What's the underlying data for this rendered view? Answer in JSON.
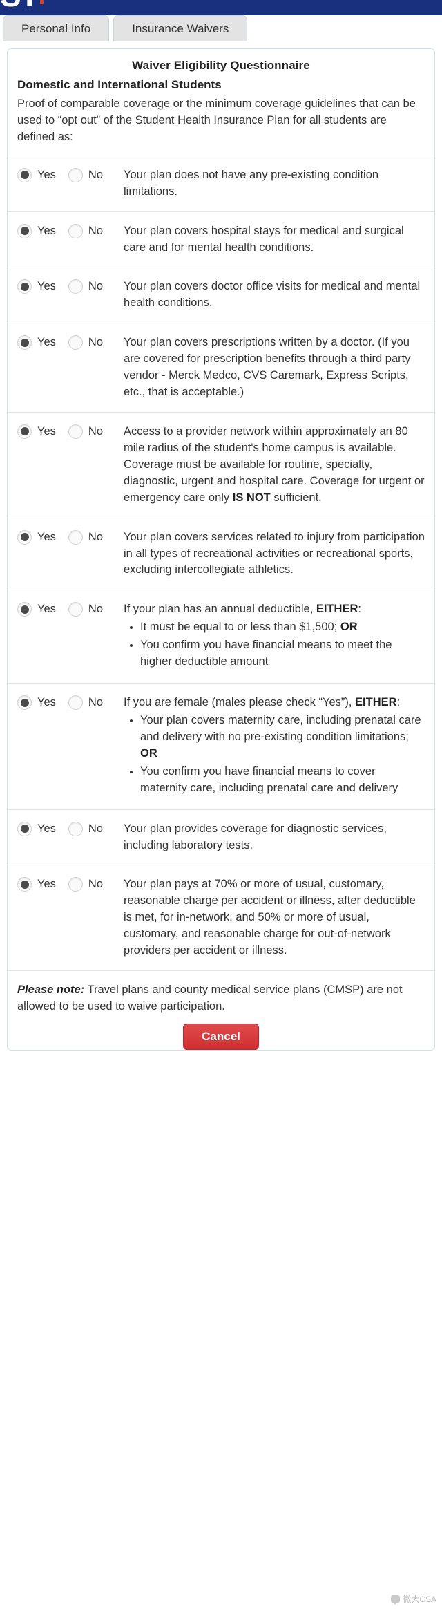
{
  "header": {
    "logo_text": "ST",
    "bar_color": "#18307e",
    "accent_color": "#c8472f"
  },
  "tabs": [
    {
      "label": "Personal Info",
      "name": "tab-personal-info",
      "selected": false
    },
    {
      "label": "Insurance Waivers",
      "name": "tab-insurance-waivers",
      "selected": true
    }
  ],
  "card": {
    "title": "Waiver Eligibility Questionnaire",
    "subtitle": "Domestic and International Students",
    "intro": "Proof of comparable coverage or the minimum coverage guidelines that can be used to “opt out” of the Student Health Insurance Plan for all students are defined as:"
  },
  "options": {
    "yes_label": "Yes",
    "no_label": "No"
  },
  "questions": [
    {
      "id": "q1-preexisting",
      "selected": "yes",
      "text": "Your plan does not have any pre-existing condition limitations."
    },
    {
      "id": "q2-hospital",
      "selected": "yes",
      "text": "Your plan covers hospital stays for medical and surgical care and for mental health conditions."
    },
    {
      "id": "q3-doctor-visits",
      "selected": "yes",
      "text": "Your plan covers doctor office visits for medical and mental health conditions."
    },
    {
      "id": "q4-prescriptions",
      "selected": "yes",
      "text": "Your plan covers prescriptions written by a doctor. (If you are covered for prescription benefits through a third party vendor - Merck Medco, CVS Caremark, Express Scripts, etc., that is acceptable.)"
    },
    {
      "id": "q5-provider-network",
      "selected": "yes",
      "text_parts": [
        {
          "type": "text",
          "value": "Access to a provider network within approximately an 80 mile radius of the student's home campus is available. Coverage must be available for routine, specialty, diagnostic, urgent and hospital care. Coverage for urgent or emergency care only "
        },
        {
          "type": "bold",
          "value": "IS NOT"
        },
        {
          "type": "text",
          "value": " sufficient."
        }
      ]
    },
    {
      "id": "q6-recreational",
      "selected": "yes",
      "text": "Your plan covers services related to injury from participation in all types of recreational activities or recreational sports, excluding intercollegiate athletics."
    },
    {
      "id": "q7-deductible",
      "selected": "yes",
      "lead_parts": [
        {
          "type": "text",
          "value": "If your plan has an annual deductible, "
        },
        {
          "type": "bold",
          "value": "EITHER"
        },
        {
          "type": "text",
          "value": ":"
        }
      ],
      "bullets": [
        [
          {
            "type": "text",
            "value": "It must be equal to or less than $1,500; "
          },
          {
            "type": "bold",
            "value": "OR"
          }
        ],
        [
          {
            "type": "text",
            "value": "You confirm you have financial means to meet the higher deductible amount"
          }
        ]
      ]
    },
    {
      "id": "q8-maternity",
      "selected": "yes",
      "lead_parts": [
        {
          "type": "text",
          "value": "If you are female (males please check “Yes”), "
        },
        {
          "type": "bold",
          "value": "EITHER"
        },
        {
          "type": "text",
          "value": ":"
        }
      ],
      "bullets": [
        [
          {
            "type": "text",
            "value": "Your plan covers maternity care, including prenatal care and delivery with no pre-existing condition limitations; "
          },
          {
            "type": "bold",
            "value": "OR"
          }
        ],
        [
          {
            "type": "text",
            "value": "You confirm you have financial means to cover maternity care, including prenatal care and delivery"
          }
        ]
      ]
    },
    {
      "id": "q9-diagnostic",
      "selected": "yes",
      "text": "Your plan provides coverage for diagnostic services, including laboratory tests."
    },
    {
      "id": "q10-coinsurance",
      "selected": "yes",
      "text": "Your plan pays at 70% or more of usual, customary, reasonable charge per accident or illness, after deductible is met, for in-network, and 50% or more of usual, customary, and reasonable charge for out-of-network providers per accident or illness."
    }
  ],
  "footer": {
    "note_bold": "Please note:",
    "note_text": " Travel plans and county medical service plans (CMSP) are not allowed to be used to waive participation.",
    "cancel_label": "Cancel",
    "cancel_color": "#d9393b"
  },
  "watermark": {
    "text": "微大CSA",
    "icon": "chat-bubble-icon"
  }
}
